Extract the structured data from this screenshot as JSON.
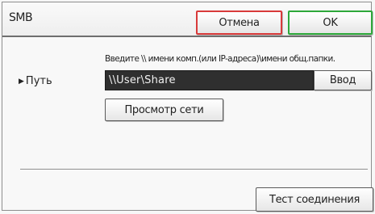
{
  "dialog": {
    "title": "SMB",
    "cancel_label": "Отмена",
    "ok_label": "OK"
  },
  "path": {
    "hint": "Введите \\\\ имени комп.(или IP-адреса)\\имени общ.папки.",
    "label": "Путь",
    "value": "\\\\User\\Share",
    "enter_label": "Ввод",
    "browse_label": "Просмотр сети"
  },
  "footer": {
    "test_label": "Тест соединения"
  },
  "colors": {
    "cancel_border": "#d83a3a",
    "ok_border": "#2da83a",
    "field_bg": "#2f2f2f"
  },
  "icons": {
    "path_marker": "triangle-right-icon"
  }
}
